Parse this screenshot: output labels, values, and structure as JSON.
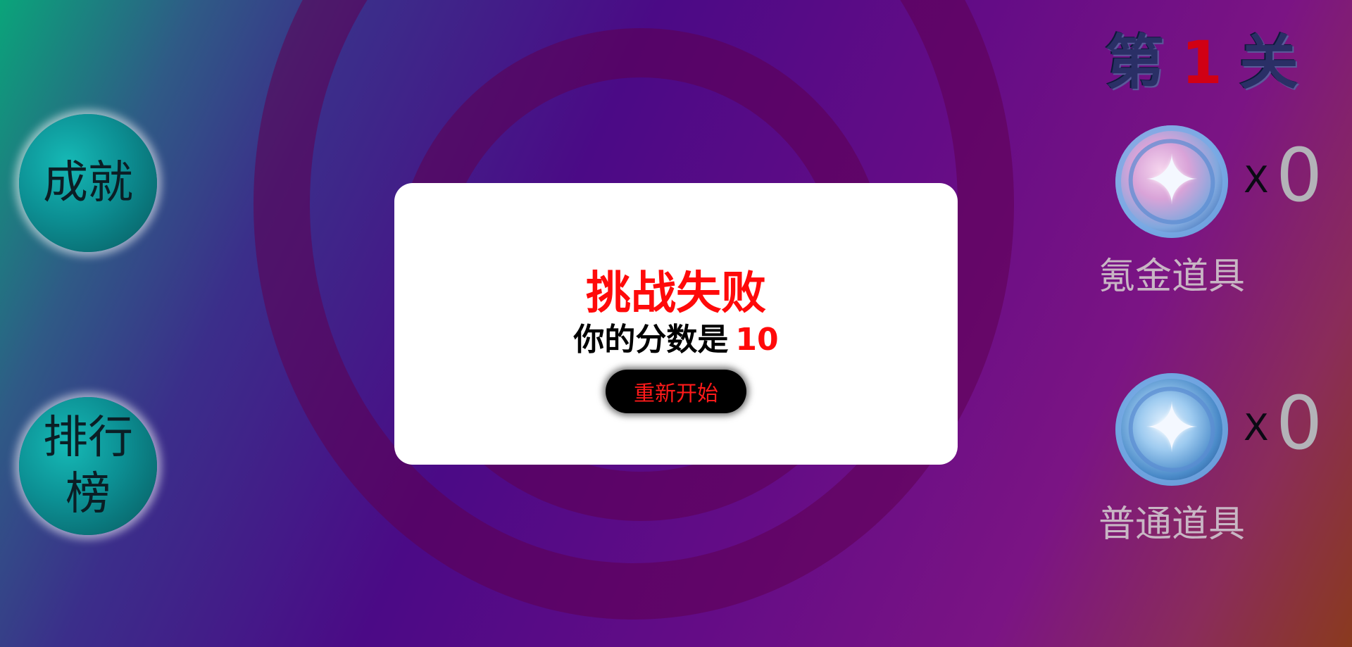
{
  "sidebar": {
    "achievements_label": "成就",
    "ranking_label": "排行榜"
  },
  "level": {
    "prefix": "第",
    "number": "1",
    "suffix": "关"
  },
  "items": [
    {
      "label": "氪金道具",
      "times": "X",
      "count": "0",
      "icon": "pink-star-orb-icon"
    },
    {
      "label": "普通道具",
      "times": "X",
      "count": "0",
      "icon": "blue-star-orb-icon"
    }
  ],
  "modal": {
    "title": "挑战失败",
    "score_prefix": "你的分数是",
    "score_value": "10",
    "restart_label": "重新开始"
  },
  "colors": {
    "accent_red": "#ff0a0a",
    "modal_bg": "#ffffff",
    "sidebar_button": "#0c8f93"
  }
}
